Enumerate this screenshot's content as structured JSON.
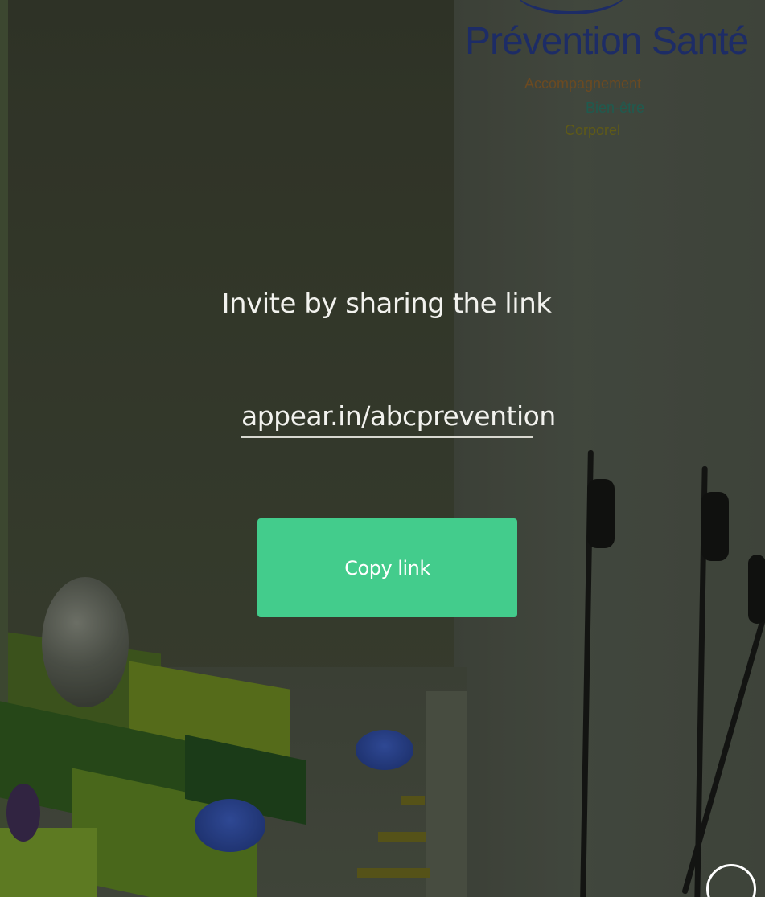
{
  "logo": {
    "title": "Prévention Santé",
    "tag_1": "Accompagnement",
    "tag_2": "Bien-être",
    "tag_3": "Corporel"
  },
  "invite": {
    "heading": "Invite by sharing the link",
    "link": "appear.in/abcprevention",
    "copy_button_label": "Copy link"
  },
  "colors": {
    "accent": "#43cc8c",
    "logo_blue": "#1d2c66"
  },
  "icons": {
    "corner_control": "circle-icon"
  }
}
